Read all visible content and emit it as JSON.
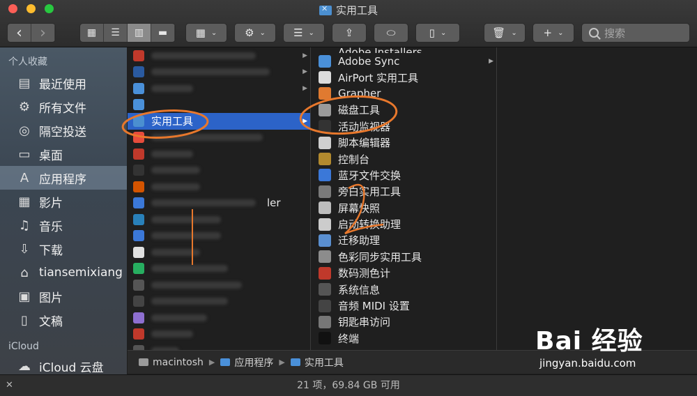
{
  "window": {
    "title": "实用工具"
  },
  "toolbar": {
    "back": "‹",
    "forward": "›",
    "search_placeholder": "搜索"
  },
  "sidebar": {
    "favorites_header": "个人收藏",
    "favorites": [
      {
        "label": "最近使用",
        "icon": "recents-icon",
        "glyph": "▤"
      },
      {
        "label": "所有文件",
        "icon": "gear-icon",
        "glyph": "⚙"
      },
      {
        "label": "隔空投送",
        "icon": "airdrop-icon",
        "glyph": "◎"
      },
      {
        "label": "桌面",
        "icon": "desktop-icon",
        "glyph": "▭"
      },
      {
        "label": "应用程序",
        "icon": "applications-icon",
        "glyph": "A"
      },
      {
        "label": "影片",
        "icon": "movies-icon",
        "glyph": "▦"
      },
      {
        "label": "音乐",
        "icon": "music-icon",
        "glyph": "♫"
      },
      {
        "label": "下载",
        "icon": "download-icon",
        "glyph": "⇩"
      },
      {
        "label": "tiansemixiang",
        "icon": "home-icon",
        "glyph": "⌂"
      },
      {
        "label": "图片",
        "icon": "pictures-icon",
        "glyph": "▣"
      },
      {
        "label": "文稿",
        "icon": "documents-icon",
        "glyph": "▯"
      }
    ],
    "icloud_header": "iCloud",
    "icloud_item": "iCloud 云盘"
  },
  "column1": {
    "selected_label": "实用工具",
    "partial_label": "ler"
  },
  "column2": {
    "top_partial": "Adobe Installers",
    "items": [
      {
        "label": "Adobe Sync",
        "icon": "folder-icon",
        "color": "#4a90d9",
        "folder": true
      },
      {
        "label": "AirPort 实用工具",
        "icon": "airport-utility-icon",
        "color": "#dcdcdc",
        "folder": false
      },
      {
        "label": "Grapher",
        "icon": "grapher-icon",
        "color": "#e07a30",
        "folder": false
      },
      {
        "label": "磁盘工具",
        "icon": "disk-utility-icon",
        "color": "#9a9a9a",
        "folder": false
      },
      {
        "label": "活动监视器",
        "icon": "activity-monitor-icon",
        "color": "#333333",
        "folder": false
      },
      {
        "label": "脚本编辑器",
        "icon": "script-editor-icon",
        "color": "#cfcfcf",
        "folder": false
      },
      {
        "label": "控制台",
        "icon": "console-icon",
        "color": "#b28a2e",
        "folder": false
      },
      {
        "label": "蓝牙文件交换",
        "icon": "bluetooth-icon",
        "color": "#3b78d8",
        "folder": false
      },
      {
        "label": "旁白实用工具",
        "icon": "voiceover-icon",
        "color": "#7a7a7a",
        "folder": false
      },
      {
        "label": "屏幕快照",
        "icon": "screenshot-icon",
        "color": "#bdbdbd",
        "folder": false
      },
      {
        "label": "启动转换助理",
        "icon": "boot-camp-icon",
        "color": "#cccccc",
        "folder": false
      },
      {
        "label": "迁移助理",
        "icon": "migration-icon",
        "color": "#5a8fd0",
        "folder": false
      },
      {
        "label": "色彩同步实用工具",
        "icon": "colorsync-icon",
        "color": "#8c8c8c",
        "folder": false
      },
      {
        "label": "数码测色计",
        "icon": "color-meter-icon",
        "color": "#c0392b",
        "folder": false
      },
      {
        "label": "系统信息",
        "icon": "system-info-icon",
        "color": "#555555",
        "folder": false
      },
      {
        "label": "音频 MIDI 设置",
        "icon": "audio-midi-icon",
        "color": "#444444",
        "folder": false
      },
      {
        "label": "钥匙串访问",
        "icon": "keychain-icon",
        "color": "#777777",
        "folder": false
      },
      {
        "label": "终端",
        "icon": "terminal-icon",
        "color": "#111111",
        "folder": false
      }
    ]
  },
  "pathbar": {
    "items": [
      "macintosh",
      "应用程序",
      "实用工具"
    ]
  },
  "statusbar": {
    "text": "21 项，69.84 GB 可用"
  },
  "watermark": {
    "brand": "Bai 经验",
    "url": "jingyan.baidu.com"
  }
}
